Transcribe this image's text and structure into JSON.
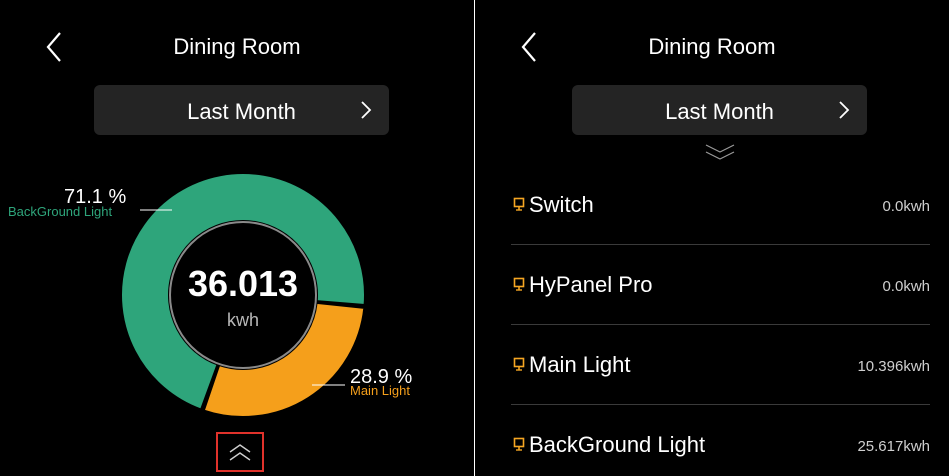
{
  "left": {
    "title": "Dining Room",
    "period": "Last Month",
    "total": {
      "value": "36.013",
      "unit": "kwh"
    },
    "slices": [
      {
        "percent_label": "71.1 %",
        "legend": "BackGround Light",
        "value": 71.1,
        "color": "#2ea57b"
      },
      {
        "percent_label": "28.9 %",
        "legend": "Main Light",
        "value": 28.9,
        "color": "#f59f1b"
      }
    ],
    "expand_icon": "chevrons-up-icon"
  },
  "right": {
    "title": "Dining Room",
    "period": "Last Month",
    "collapse_icon": "chevrons-down-icon",
    "devices": [
      {
        "name": "Switch",
        "value": "0.0kwh"
      },
      {
        "name": "HyPanel Pro",
        "value": "0.0kwh"
      },
      {
        "name": "Main Light",
        "value": "10.396kwh"
      },
      {
        "name": "BackGround Light",
        "value": "25.617kwh"
      }
    ],
    "device_icon_color": "#f5a623"
  },
  "chart_data": {
    "type": "pie",
    "categories": [
      "BackGround Light",
      "Main Light"
    ],
    "values": [
      71.1,
      28.9
    ],
    "center_label": "36.013",
    "center_unit": "kwh"
  }
}
